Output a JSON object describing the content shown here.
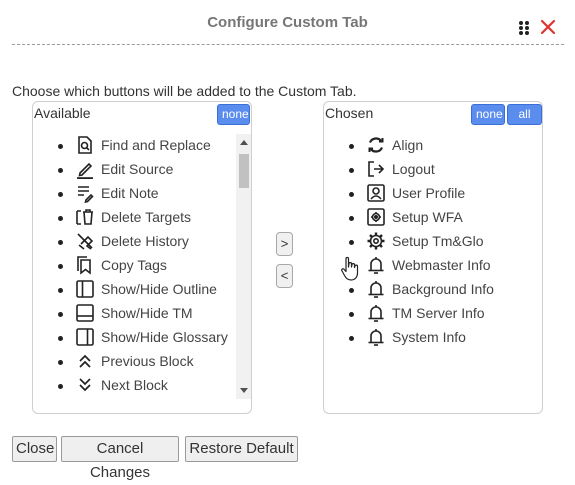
{
  "dialog": {
    "title": "Configure Custom Tab",
    "instruction": "Choose which buttons will be added to the Custom Tab."
  },
  "available": {
    "label": "Available",
    "none_label": "none",
    "items": [
      {
        "label": "Find and Replace",
        "icon": "find-replace-icon"
      },
      {
        "label": "Edit Source",
        "icon": "pencil-icon"
      },
      {
        "label": "Edit Note",
        "icon": "note-pen-icon"
      },
      {
        "label": "Delete Targets",
        "icon": "delete-targets-icon"
      },
      {
        "label": "Delete History",
        "icon": "delete-history-icon"
      },
      {
        "label": "Copy Tags",
        "icon": "copy-tags-icon"
      },
      {
        "label": "Show/Hide Outline",
        "icon": "panel-left-icon"
      },
      {
        "label": "Show/Hide TM",
        "icon": "panel-bottom-icon"
      },
      {
        "label": "Show/Hide Glossary",
        "icon": "panel-right-icon"
      },
      {
        "label": "Previous Block",
        "icon": "chevrons-up-icon"
      },
      {
        "label": "Next Block",
        "icon": "chevrons-down-icon"
      }
    ]
  },
  "chosen": {
    "label": "Chosen",
    "none_label": "none",
    "all_label": "all",
    "items": [
      {
        "label": "Align",
        "icon": "align-sync-icon"
      },
      {
        "label": "Logout",
        "icon": "logout-icon"
      },
      {
        "label": "User Profile",
        "icon": "user-profile-icon"
      },
      {
        "label": "Setup WFA",
        "icon": "gear-box-icon"
      },
      {
        "label": "Setup Tm&Glo",
        "icon": "gear-icon"
      },
      {
        "label": "Webmaster Info",
        "icon": "bell-icon"
      },
      {
        "label": "Background Info",
        "icon": "bell-icon"
      },
      {
        "label": "TM Server Info",
        "icon": "bell-icon"
      },
      {
        "label": "System Info",
        "icon": "bell-icon"
      }
    ]
  },
  "move": {
    "add_label": ">",
    "remove_label": "<"
  },
  "buttons": {
    "close": "Close",
    "cancel": "Cancel Changes",
    "restore": "Restore Default"
  },
  "colors": {
    "accent": "#5b8def",
    "close_x": "#e0322e"
  }
}
